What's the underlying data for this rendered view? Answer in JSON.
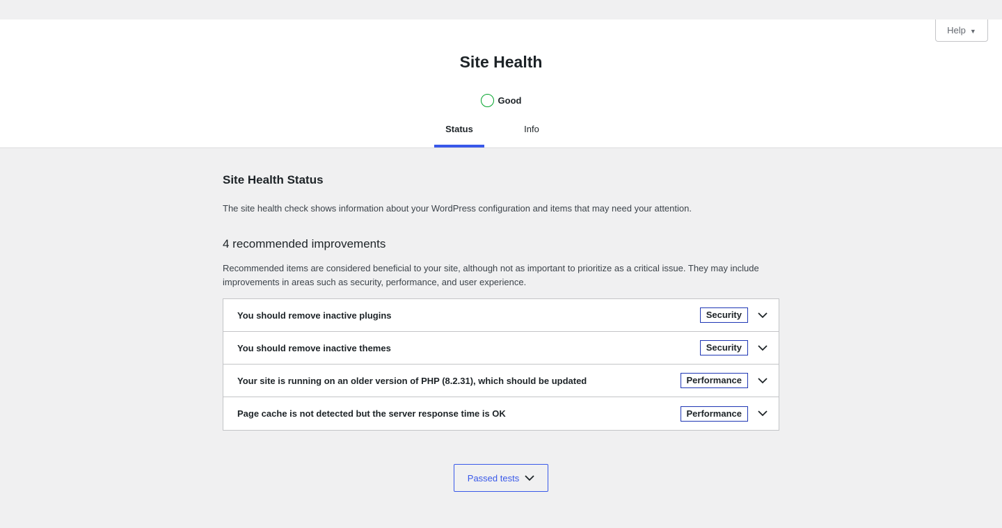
{
  "help": {
    "label": "Help",
    "caret_icon": "caret-down-icon"
  },
  "header": {
    "title": "Site Health",
    "status": {
      "label": "Good",
      "color": "#00a32a"
    },
    "tabs": [
      {
        "label": "Status",
        "active": true
      },
      {
        "label": "Info",
        "active": false
      }
    ]
  },
  "main": {
    "section_title": "Site Health Status",
    "section_desc": "The site health check shows information about your WordPress configuration and items that may need your attention.",
    "improvements_title": "4 recommended improvements",
    "improvements_desc": "Recommended items are considered beneficial to your site, although not as important to prioritize as a critical issue. They may include improvements in areas such as security, performance, and user experience.",
    "issues": [
      {
        "title": "You should remove inactive plugins",
        "badge": "Security"
      },
      {
        "title": "You should remove inactive themes",
        "badge": "Security"
      },
      {
        "title": "Your site is running on an older version of PHP (8.2.31), which should be updated",
        "badge": "Performance"
      },
      {
        "title": "Page cache is not detected but the server response time is OK",
        "badge": "Performance"
      }
    ],
    "passed_tests_label": "Passed tests"
  },
  "colors": {
    "accent": "#3858e9",
    "badge_border": "#1d35b4",
    "good": "#00a32a",
    "background": "#f0f0f1"
  }
}
